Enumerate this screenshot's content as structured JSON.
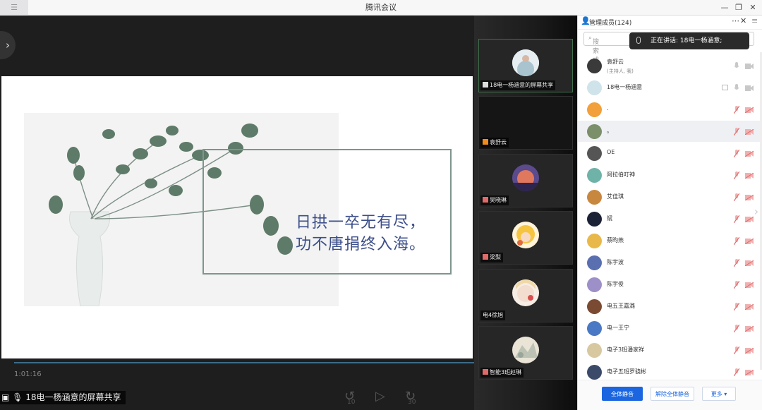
{
  "window": {
    "title": "腾讯会议"
  },
  "slide": {
    "quote_line1": "日拱一卒无有尽，",
    "quote_line2": "功不唐捐终入海。"
  },
  "player": {
    "elapsed": "1:01:16",
    "progress_fraction": 0.98,
    "rewind_label": "10",
    "forward_label": "30"
  },
  "share_label": "18电一杨涵意的屏幕共享",
  "tiles": [
    {
      "label": "18电一杨涵意的屏幕共享"
    },
    {
      "label": "袁舒云"
    },
    {
      "label": "吴晓琳"
    },
    {
      "label": "梁梨"
    },
    {
      "label": "电4徐旭"
    },
    {
      "label": "智能3班赵琳"
    }
  ],
  "panel": {
    "title": "管理成员(124)",
    "search_placeholder": "搜索成员",
    "speaking_text": "正在讲话: 18电一杨涵意;",
    "members": [
      {
        "name": "袁舒云",
        "role": "(主持人, 我)"
      },
      {
        "name": "18电一杨涵意"
      },
      {
        "name": "."
      },
      {
        "name": "。"
      },
      {
        "name": "OE"
      },
      {
        "name": "阿拉伯叮神"
      },
      {
        "name": "艾佳琪"
      },
      {
        "name": "斌"
      },
      {
        "name": "蔡昀燕"
      },
      {
        "name": "陈宇波"
      },
      {
        "name": "陈宇俊"
      },
      {
        "name": "电五王嘉潞"
      },
      {
        "name": "电一王宁"
      },
      {
        "name": "电子3班潘家祥"
      },
      {
        "name": "电子五班罗骁彬"
      }
    ],
    "mute_all": "全体静音",
    "unmute_all": "解除全体静音",
    "more": "更多"
  },
  "colors": {
    "accent": "#1b66e0",
    "mic_muted": "#e06a6a",
    "frame": "#7d958e",
    "quote": "#3c4e8a"
  }
}
